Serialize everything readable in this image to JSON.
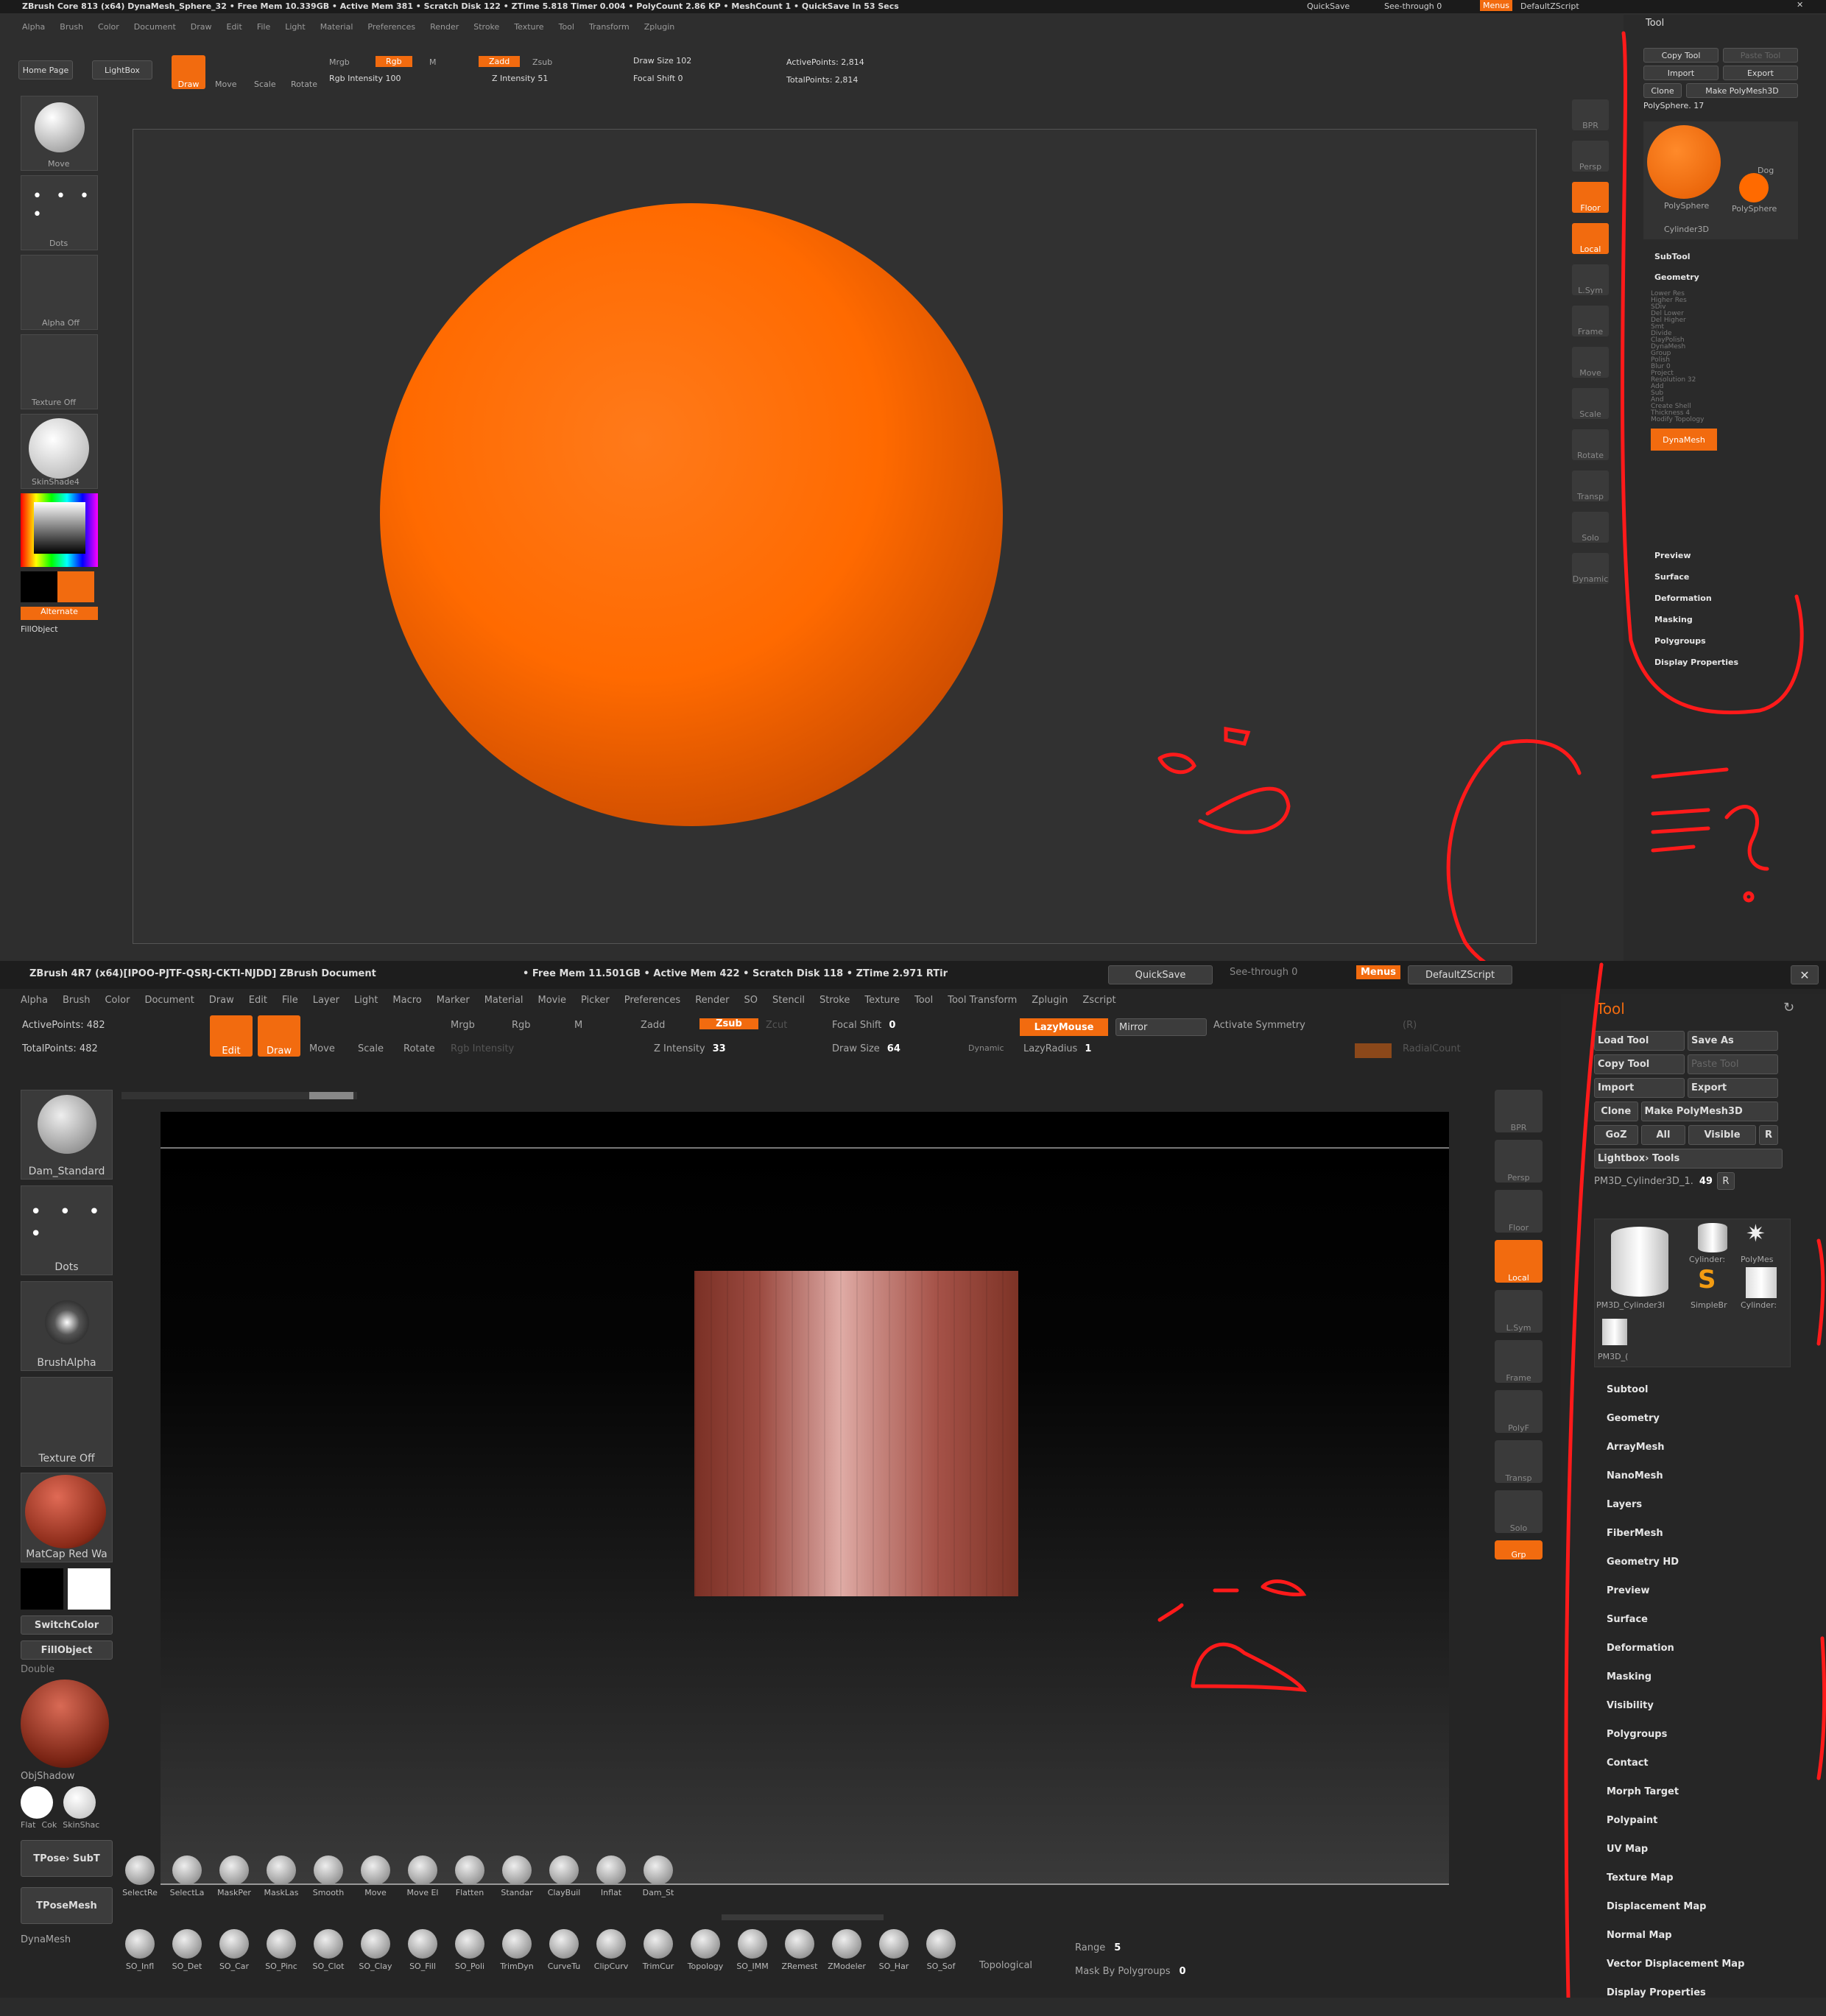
{
  "top": {
    "titlebar": "ZBrush Core 813 (x64)   DynaMesh_Sphere_32   • Free Mem 10.339GB • Active Mem 381 • Scratch Disk 122 • ZTime 5.818 Timer 0.004 • PolyCount 2.86 KP • MeshCount 1 • QuickSave In 53 Secs",
    "quicksave": "QuickSave",
    "seethrough": "See-through 0",
    "menus": "Menus",
    "script": "DefaultZScript",
    "menu_items": [
      "Alpha",
      "Brush",
      "Color",
      "Document",
      "Draw",
      "Edit",
      "File",
      "Light",
      "Material",
      "Preferences",
      "Render",
      "Stroke",
      "Texture",
      "Tool",
      "Transform",
      "Zplugin"
    ],
    "home_page": "Home Page",
    "lightbox": "LightBox",
    "draw": "Draw",
    "move": "Move",
    "scale": "Scale",
    "rotate": "Rotate",
    "mrgb": "Mrgb",
    "rgb": "Rgb",
    "m": "M",
    "rgb_intensity": "Rgb Intensity 100",
    "zadd": "Zadd",
    "zsub": "Zsub",
    "z_intensity": "Z Intensity 51",
    "draw_size": "Draw Size 102",
    "focal_shift": "Focal Shift 0",
    "active_points": "ActivePoints: 2,814",
    "total_points": "TotalPoints: 2,814",
    "left_labels": [
      "Move",
      "Dots",
      "Alpha Off",
      "Texture Off",
      "SkinShade4"
    ],
    "alternate": "Alternate",
    "fillobject": "FillObject",
    "tool_title": "Tool",
    "tool_buttons": [
      "Copy Tool",
      "Paste Tool",
      "Import",
      "Export",
      "Clone",
      "Make PolyMesh3D"
    ],
    "polysphere": "PolySphere. 17",
    "thumb_labels": [
      "PolySphere",
      "Dog",
      "PolySphere",
      "Cylinder3D"
    ],
    "subtool": "SubTool",
    "geometry": "Geometry",
    "geo_rows": [
      "Lower Res",
      "Higher Res",
      "SDiv",
      "Del Lower",
      "Del Higher",
      "Smt",
      "Divide",
      "ClayPolish",
      "DynaMesh",
      "Group",
      "Polish",
      "Blur 0",
      "Project",
      "Resolution 32",
      "Add",
      "Sub",
      "And",
      "Create Shell",
      "Thickness 4",
      "Modify Topology"
    ],
    "dynamesh_btn": "DynaMesh",
    "panel_sections": [
      "Preview",
      "Surface",
      "Deformation",
      "Masking",
      "Polygroups",
      "Display Properties"
    ],
    "right_tray": [
      "BPR",
      "Persp",
      "Floor",
      "Local",
      "L.Sym",
      "Frame",
      "Move",
      "Scale",
      "Rotate",
      "Transp",
      "Solo",
      "Dynamic"
    ]
  },
  "bottom": {
    "titlebar": "ZBrush 4R7 (x64)[IPOO-PJTF-QSRJ-CKTI-NJDD]    ZBrush Document",
    "stats": "• Free Mem 11.501GB • Active Mem 422 • Scratch Disk 118 •  ZTime 2.971 RTir",
    "quicksave": "QuickSave",
    "seethrough": "See-through  0",
    "menus": "Menus",
    "script": "DefaultZScript",
    "menu_items": [
      "Alpha",
      "Brush",
      "Color",
      "Document",
      "Draw",
      "Edit",
      "File",
      "Layer",
      "Light",
      "Macro",
      "Marker",
      "Material",
      "Movie",
      "Picker",
      "Preferences",
      "Render",
      "SO",
      "Stencil",
      "Stroke",
      "Texture",
      "Tool",
      "Tool Transform",
      "Zplugin",
      "Zscript"
    ],
    "active_points": "ActivePoints: 482",
    "total_points": "TotalPoints: 482",
    "edit": "Edit",
    "draw": "Draw",
    "move": "Move",
    "scale": "Scale",
    "rotate": "Rotate",
    "mrgb": "Mrgb",
    "rgb": "Rgb",
    "m": "M",
    "rgb_intensity": "Rgb Intensity",
    "zadd": "Zadd",
    "zsub": "Zsub",
    "zcut": "Zcut",
    "z_intensity_label": "Z Intensity",
    "z_intensity_value": "33",
    "focal_shift_label": "Focal Shift",
    "focal_shift_value": "0",
    "draw_size_label": "Draw Size",
    "draw_size_value": "64",
    "dynamic": "Dynamic",
    "lazymouse": "LazyMouse",
    "lazyradius_label": "LazyRadius",
    "lazyradius_value": "1",
    "mirror": "Mirror",
    "activate_symmetry": "Activate Symmetry",
    "r_key": "(R)",
    "radialcount": "RadialCount",
    "left_labels": [
      "Dam_Standard",
      "Dots",
      "BrushAlpha",
      "Texture Off",
      "MatCap Red Wa"
    ],
    "switchcolor": "SwitchColor",
    "fillobject": "FillObject",
    "double": "Double",
    "objshadow": "ObjShadow",
    "flat_labels": [
      "Flat",
      "Cok",
      "SkinShac"
    ],
    "tpose_subt": "TPose› SubT",
    "tposemesh": "TPoseMesh",
    "dynamesh": "DynaMesh",
    "right_tray": [
      "BPR",
      "Persp",
      "Floor",
      "Local",
      "L.Sym",
      "Frame",
      "PolyF",
      "Transp",
      "Solo",
      "Grp"
    ],
    "tool_title": "Tool",
    "tool_buttons": [
      "Load Tool",
      "Save As",
      "Copy Tool",
      "Paste Tool",
      "Import",
      "Export",
      "Clone",
      "Make PolyMesh3D",
      "GoZ",
      "All",
      "Visible",
      "R",
      "Lightbox› Tools"
    ],
    "tool_name": "PM3D_Cylinder3D_1.",
    "tool_count": "49",
    "tool_thumbs": [
      "PM3D_Cylinder3I",
      "Cylinder:",
      "PolyMes",
      "SimpleBr",
      "Cylinder:",
      "PM3D_("
    ],
    "tool_sections": [
      "Subtool",
      "Geometry",
      "ArrayMesh",
      "NanoMesh",
      "Layers",
      "FiberMesh",
      "Geometry HD",
      "Preview",
      "Surface",
      "Deformation",
      "Masking",
      "Visibility",
      "Polygroups",
      "Contact",
      "Morph Target",
      "Polypaint",
      "UV Map",
      "Texture Map",
      "Displacement Map",
      "Normal Map",
      "Vector Displacement Map",
      "Display Properties"
    ],
    "shelf1": [
      "SelectRe",
      "SelectLa",
      "MaskPer",
      "MaskLas",
      "Smooth",
      "Move",
      "Move El",
      "Flatten",
      "Standar",
      "ClayBuil",
      "Inflat",
      "Dam_St"
    ],
    "shelf2": [
      "SO_Infl",
      "SO_Det",
      "SO_Car",
      "SO_Pinc",
      "SO_Clot",
      "SO_Clay",
      "SO_Fill",
      "SO_Poli",
      "TrimDyn",
      "CurveTu",
      "ClipCurv",
      "TrimCur",
      "Topology",
      "SO_IMM",
      "ZRemest",
      "ZModeler",
      "SO_Har",
      "SO_Sof"
    ],
    "topological": "Topological",
    "range_label": "Range",
    "range_value": "5",
    "mask_by_polygroups_label": "Mask By Polygroups",
    "mask_by_polygroups_value": "0"
  },
  "colors": {
    "accent": "#f26b0f",
    "sphere": "#ff6a00",
    "annotation": "#ff1a1a",
    "cylinder": "#b3605a"
  }
}
